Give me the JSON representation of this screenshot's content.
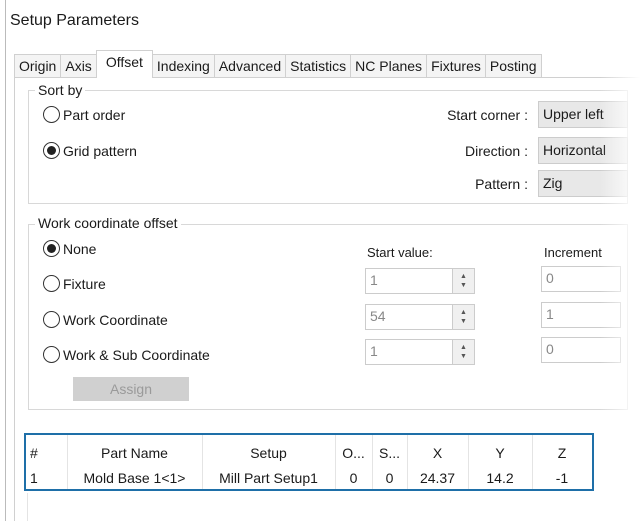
{
  "window": {
    "title": "Setup Parameters"
  },
  "tabs": [
    "Origin",
    "Axis",
    "Offset",
    "Indexing",
    "Advanced",
    "Statistics",
    "NC Planes",
    "Fixtures",
    "Posting"
  ],
  "selected_tab": "Offset",
  "sort_by": {
    "label": "Sort by",
    "options": [
      "Part order",
      "Grid pattern"
    ],
    "selected": "Grid pattern",
    "start_corner_label": "Start corner :",
    "start_corner": "Upper left",
    "direction_label": "Direction :",
    "direction": "Horizontal",
    "pattern_label": "Pattern :",
    "pattern": "Zig"
  },
  "wco": {
    "label": "Work coordinate offset",
    "options": [
      "None",
      "Fixture",
      "Work Coordinate",
      "Work & Sub Coordinate"
    ],
    "selected": "None",
    "start_label": "Start value:",
    "increment_label": "Increment",
    "start_values": [
      "1",
      "54",
      "1"
    ],
    "increments": [
      "0",
      "1",
      "0"
    ],
    "assign_label": "Assign"
  },
  "table": {
    "headers": [
      "#",
      "Part Name",
      "Setup",
      "O...",
      "S...",
      "X",
      "Y",
      "Z"
    ],
    "rows": [
      [
        "1",
        "Mold Base 1<1>",
        "Mill Part Setup1",
        "0",
        "0",
        "24.37",
        "14.2",
        "-1"
      ]
    ]
  },
  "colors": {
    "highlight": "#1e6fa8"
  }
}
